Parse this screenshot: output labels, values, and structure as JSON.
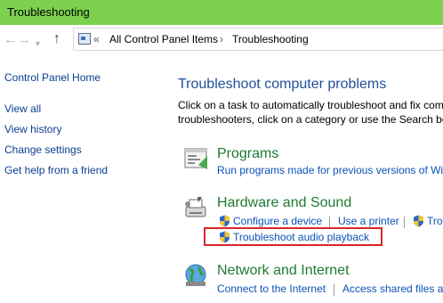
{
  "window": {
    "title": "Troubleshooting"
  },
  "nav": {
    "breadcrumb_sep": "«",
    "breadcrumb": [
      "All Control Panel Items",
      "Troubleshooting"
    ],
    "crumb_arrow": "›"
  },
  "sidebar": {
    "items": [
      {
        "label": "Control Panel Home"
      },
      {
        "label": "View all"
      },
      {
        "label": "View history"
      },
      {
        "label": "Change settings"
      },
      {
        "label": "Get help from a friend"
      }
    ]
  },
  "main": {
    "title": "Troubleshoot computer problems",
    "description_lines": [
      "Click on a task to automatically troubleshoot and fix com",
      "troubleshooters, click on a category or use the Search bo"
    ],
    "categories": [
      {
        "title": "Programs",
        "icon": "programs-icon",
        "links": [
          {
            "label": "Run programs made for previous versions of Win",
            "shield": false
          }
        ]
      },
      {
        "title": "Hardware and Sound",
        "icon": "hardware-sound-icon",
        "links": [
          {
            "label": "Configure a device",
            "shield": true
          },
          {
            "label": "Use a printer",
            "shield": false
          },
          {
            "label": "Tro",
            "shield": true
          },
          {
            "label": "Troubleshoot audio playback",
            "shield": true
          }
        ]
      },
      {
        "title": "Network and Internet",
        "icon": "network-internet-icon",
        "links": [
          {
            "label": "Connect to the Internet",
            "shield": false
          },
          {
            "label": "Access shared files an",
            "shield": false
          }
        ]
      }
    ]
  },
  "colors": {
    "titlebar": "#7cd14e",
    "highlight_box": "#d9262a",
    "category_title": "#1e7a32",
    "link": "#0b52b8"
  }
}
